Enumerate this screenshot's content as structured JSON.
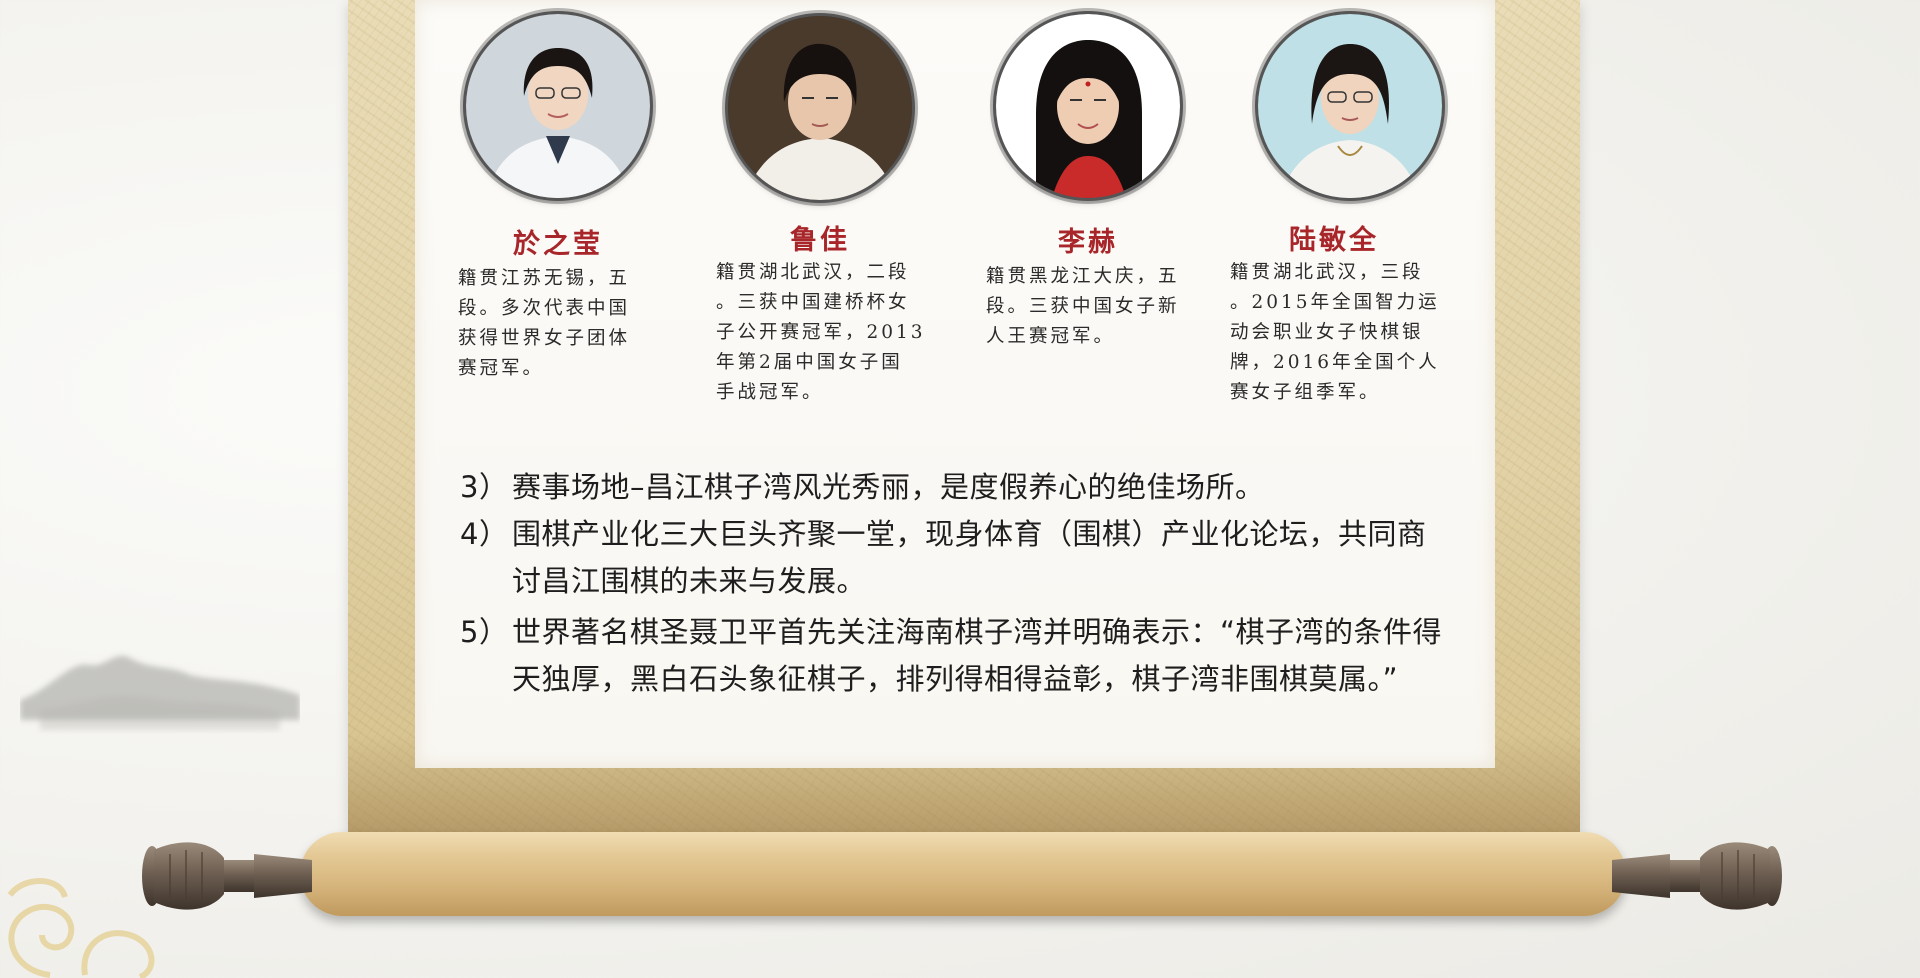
{
  "players": [
    {
      "name": "於之莹",
      "bio": [
        "籍贯江苏无锡，五",
        "段。多次代表中国",
        "获得世界女子团体",
        "赛冠军。"
      ],
      "icon": "portrait-yu-zhiying"
    },
    {
      "name": "鲁佳",
      "bio": [
        "籍贯湖北武汉，二段",
        "。三获中国建桥杯女",
        "子公开赛冠军，2013",
        "年第2届中国女子国",
        "手战冠军。"
      ],
      "icon": "portrait-lu-jia"
    },
    {
      "name": "李赫",
      "bio": [
        "籍贯黑龙江大庆，五",
        "段。三获中国女子新",
        "人王赛冠军。"
      ],
      "icon": "portrait-li-he"
    },
    {
      "name": "陆敏全",
      "bio": [
        "籍贯湖北武汉，三段",
        "。2015年全国智力运",
        "动会职业女子快棋银",
        "牌，2016年全国个人",
        "赛女子组季军。"
      ],
      "icon": "portrait-lu-minquan"
    }
  ],
  "items": [
    {
      "num": "3）",
      "lines": [
        "赛事场地–昌江棋子湾风光秀丽，是度假养心的绝佳场所。"
      ]
    },
    {
      "num": "4）",
      "lines": [
        "围棋产业化三大巨头齐聚一堂，现身体育（围棋）产业化论坛，共同商",
        "讨昌江围棋的未来与发展。"
      ]
    },
    {
      "num": "5）",
      "lines": [
        "世界著名棋圣聂卫平首先关注海南棋子湾并明确表示：“棋子湾的条件得",
        "天独厚，黑白石头象征棋子，排列得相得益彰，棋子湾非围棋莫属。”"
      ]
    }
  ],
  "colors": {
    "name_red": "#a8262a",
    "paper": "#fcfbf8",
    "scroll_gold": "#e2d2a6",
    "rod": "#d7b67d"
  }
}
